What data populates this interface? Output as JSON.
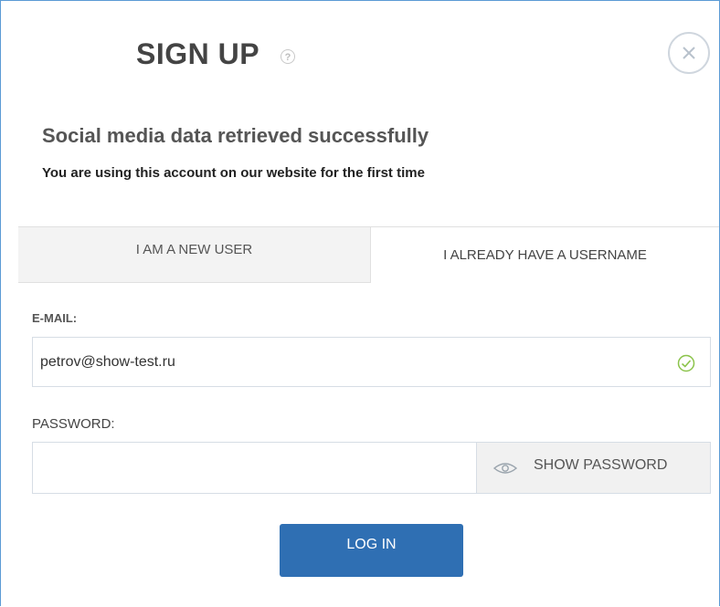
{
  "dialog": {
    "title": "SIGN UP",
    "help_icon": "question-icon",
    "close_icon": "close-icon"
  },
  "status": {
    "message": "Social media data retrieved successfully",
    "sub_message": "You are using this account on our website for the first time"
  },
  "tabs": [
    {
      "label": "I AM A NEW USER",
      "active": false
    },
    {
      "label": "I ALREADY HAVE A USERNAME",
      "active": true
    }
  ],
  "form": {
    "email_label": "E-MAIL:",
    "email_value": "petrov@show-test.ru",
    "email_valid_icon": "check-circle-icon",
    "password_label": "PASSWORD:",
    "password_value": "",
    "show_password_label": "SHOW PASSWORD",
    "show_password_icon": "eye-icon",
    "submit_label": "LOG IN"
  },
  "colors": {
    "frame_border": "#5b9bd5",
    "primary_button": "#2f6fb3",
    "valid_green": "#8bc34a"
  }
}
